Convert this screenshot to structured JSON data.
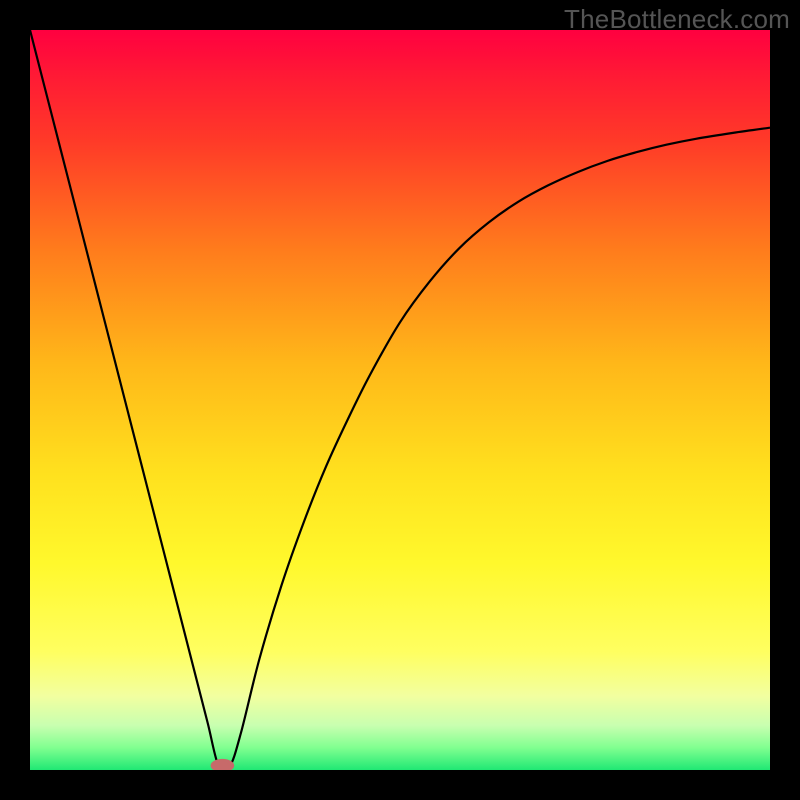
{
  "watermark": "TheBottleneck.com",
  "chart_data": {
    "type": "line",
    "title": "",
    "xlabel": "",
    "ylabel": "",
    "xlim": [
      0,
      100
    ],
    "ylim": [
      0,
      100
    ],
    "background_gradient": {
      "stops": [
        {
          "offset": 0.0,
          "color": "#ff0040"
        },
        {
          "offset": 0.06,
          "color": "#ff1935"
        },
        {
          "offset": 0.15,
          "color": "#ff3a28"
        },
        {
          "offset": 0.3,
          "color": "#ff7d1c"
        },
        {
          "offset": 0.45,
          "color": "#ffb719"
        },
        {
          "offset": 0.6,
          "color": "#ffe11e"
        },
        {
          "offset": 0.72,
          "color": "#fff82c"
        },
        {
          "offset": 0.84,
          "color": "#ffff60"
        },
        {
          "offset": 0.9,
          "color": "#f2ffa0"
        },
        {
          "offset": 0.94,
          "color": "#c8ffb0"
        },
        {
          "offset": 0.97,
          "color": "#80ff90"
        },
        {
          "offset": 1.0,
          "color": "#20e874"
        }
      ]
    },
    "series": [
      {
        "name": "bottleneck-curve",
        "color": "#000000",
        "width": 2.2,
        "x": [
          0,
          2,
          4,
          6,
          8,
          10,
          12,
          14,
          16,
          18,
          20,
          22,
          24,
          25.5,
          27,
          28.5,
          31,
          34,
          37,
          40,
          43,
          46,
          50,
          54,
          58,
          62,
          66,
          70,
          74,
          78,
          82,
          86,
          90,
          95,
          100
        ],
        "y": [
          100,
          92.2,
          84.4,
          76.6,
          68.8,
          61.0,
          53.2,
          45.4,
          37.6,
          29.8,
          22.0,
          14.2,
          6.4,
          0.5,
          0.5,
          5.0,
          15.0,
          25.0,
          33.5,
          41.0,
          47.5,
          53.5,
          60.5,
          66.0,
          70.5,
          74.0,
          76.8,
          79.0,
          80.8,
          82.3,
          83.5,
          84.5,
          85.3,
          86.1,
          86.8
        ]
      }
    ],
    "marker": {
      "name": "optimum-marker",
      "x": 26.0,
      "y": 0.6,
      "rx": 1.6,
      "ry": 0.9,
      "fill": "#c76a6a"
    }
  }
}
